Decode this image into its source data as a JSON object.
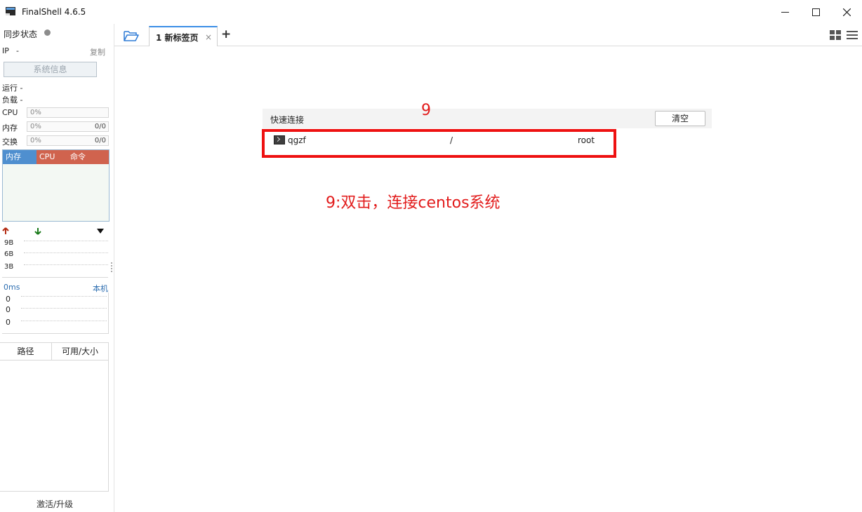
{
  "window": {
    "title": "FinalShell 4.6.5",
    "icon": "finalshell-app-icon",
    "controls": [
      "minimize-icon",
      "maximize-icon",
      "close-icon"
    ]
  },
  "sidebar": {
    "sync_status": "同步状态",
    "ip_label": "IP",
    "ip_value": "-",
    "copy": "复制",
    "sysinfo_button": "系统信息",
    "run_label": "运行 -",
    "load_label": "负载 -",
    "stats": [
      {
        "label": "CPU",
        "percent": "0%",
        "detail": ""
      },
      {
        "label": "内存",
        "percent": "0%",
        "detail": "0/0"
      },
      {
        "label": "交换",
        "percent": "0%",
        "detail": "0/0"
      }
    ],
    "process_headers": [
      "内存",
      "CPU",
      "命令"
    ],
    "process_header_colors": [
      "#4f8fcf",
      "#d0634e",
      "#d0634e"
    ],
    "network": {
      "up_icon": "arrow-up-icon",
      "down_icon": "arrow-down-icon",
      "dropdown_icon": "triangle-down-icon",
      "scale": [
        "9B",
        "6B",
        "3B"
      ]
    },
    "latency": {
      "value": "0ms",
      "host": "本机",
      "scale": [
        "0",
        "0",
        "0"
      ]
    },
    "disk_headers": [
      "路径",
      "可用/大小"
    ],
    "footer": "激活/升级"
  },
  "tabs": {
    "folder_icon": "folder-open-icon",
    "items": [
      {
        "label": "1 新标签页",
        "close": "×"
      }
    ],
    "add": "+",
    "right_icons": [
      "layout-grid-icon",
      "hamburger-menu-icon"
    ]
  },
  "quick_connect": {
    "title": "快速连接",
    "clear_button": "清空",
    "rows": [
      {
        "icon": "terminal-icon",
        "name": "qgzf",
        "path": "/",
        "user": "root"
      }
    ]
  },
  "annotation": {
    "number": "9",
    "text": "9:双击，连接centos系统",
    "color": "#e21b1b"
  },
  "colors": {
    "accent": "#3a8ee6",
    "highlight": "#ee1111"
  }
}
